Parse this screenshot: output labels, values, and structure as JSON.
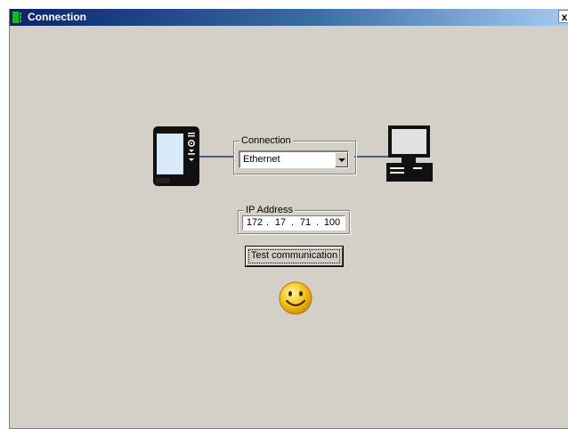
{
  "window": {
    "title": "Connection",
    "close_label": "x"
  },
  "connection_group": {
    "legend": "Connection",
    "selected": "Ethernet"
  },
  "ip_group": {
    "legend": "IP Address",
    "octets": [
      "172",
      "17",
      "71",
      "100"
    ],
    "separator": "."
  },
  "actions": {
    "test_label": "Test communication"
  },
  "icons": {
    "handheld": "handheld-device-icon",
    "computer": "computer-icon",
    "status": "smiley-icon",
    "title": "app-icon"
  },
  "colors": {
    "titlebar_start": "#0a246a",
    "titlebar_end": "#a6caf0",
    "dialog_bg": "#d4d0c8",
    "link_line": "#4a5f80",
    "smiley": "#f5c21a"
  }
}
